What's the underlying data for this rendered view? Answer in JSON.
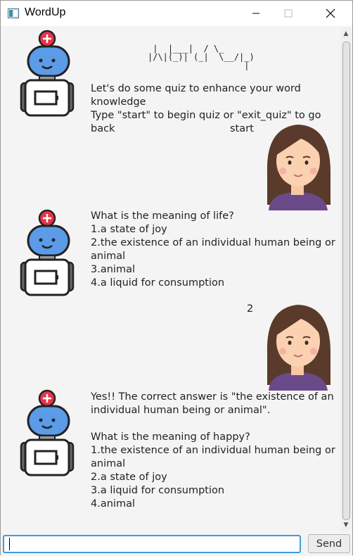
{
  "window": {
    "title": "WordUp"
  },
  "chat": {
    "messages": [
      {
        "sender": "bot",
        "ascii_art": " |  |___|  / \\_\n|/\\|(_)| (_|  \\__/|_)\n                   |",
        "text": "Let's do some quiz to enhance your word knowledge\nType \"start\" to begin quiz or \"exit_quiz\" to go back"
      },
      {
        "sender": "user",
        "text": "start"
      },
      {
        "sender": "bot",
        "text": "What is the meaning of life?\n1.a state of joy\n2.the existence of an individual human being or animal\n3.animal\n4.a liquid for consumption"
      },
      {
        "sender": "user",
        "text": "2"
      },
      {
        "sender": "bot",
        "text": "Yes!! The correct answer is \"the existence of an individual human being or animal\".\n\nWhat is the meaning of happy?\n1.the existence of an individual human being or animal\n2.a state of joy\n3.a liquid for consumption\n4.animal"
      }
    ]
  },
  "input": {
    "value": "",
    "placeholder": ""
  },
  "send_button": {
    "label": "Send"
  },
  "icons": {
    "bot_avatar": "robot-icon",
    "user_avatar": "woman-avatar-icon",
    "app": "window-app-icon"
  },
  "colors": {
    "accent_focus": "#3d9ddb",
    "robot_blue": "#5b9be8",
    "robot_red": "#e8334a",
    "hair": "#5a3a2a",
    "shirt": "#6b4a8a"
  }
}
